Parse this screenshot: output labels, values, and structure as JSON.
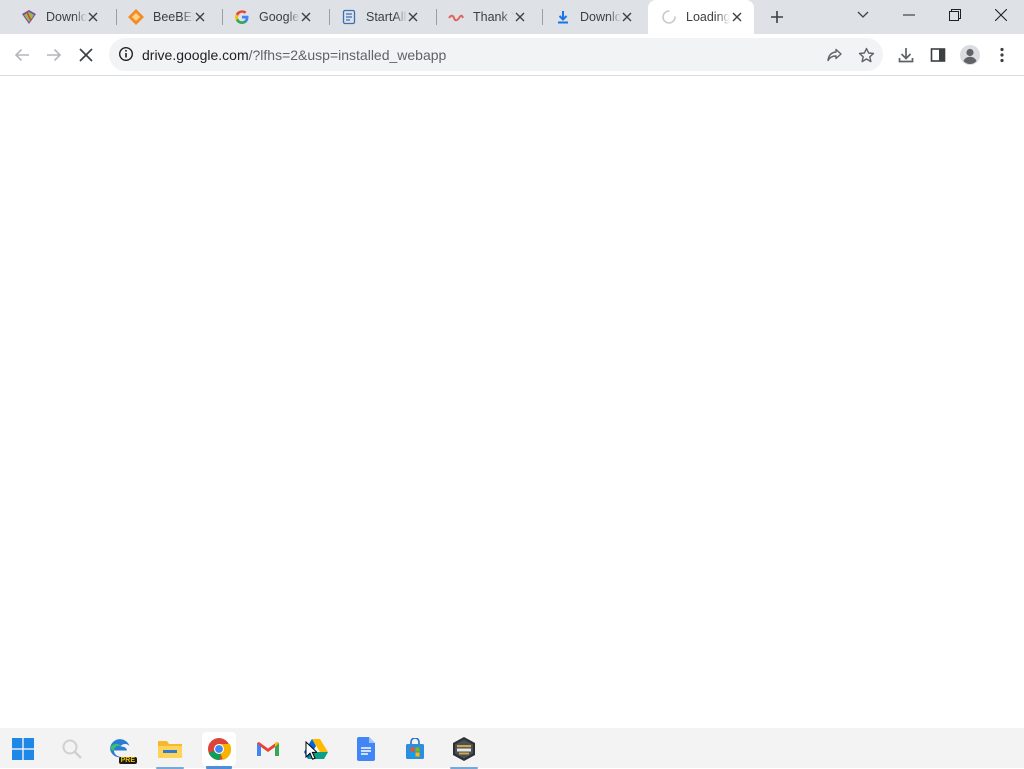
{
  "browser": {
    "tabs": [
      {
        "title": "Downlo",
        "icon": "winrar-icon"
      },
      {
        "title": "BeeBEEP",
        "icon": "beebeep-icon"
      },
      {
        "title": "Google",
        "icon": "google-g-icon"
      },
      {
        "title": "StartAllBack",
        "icon": "document-icon"
      },
      {
        "title": "Thank You",
        "icon": "link-icon"
      },
      {
        "title": "Downlo",
        "icon": "download-arrow-icon"
      },
      {
        "title": "Loading",
        "icon": "loading-spinner-icon",
        "active": true
      }
    ],
    "address": {
      "host": "drive.google.com",
      "path": "/?lfhs=2&usp=installed_webapp"
    }
  },
  "taskbar": {
    "items": [
      "windows-start-icon",
      "search-icon",
      "edge-preview-icon",
      "file-explorer-icon",
      "chrome-icon",
      "gmail-icon",
      "google-drive-icon",
      "google-docs-icon",
      "microsoft-store-icon",
      "game-app-icon"
    ],
    "edge_badge": "PRE"
  },
  "colors": {
    "tabstrip": "#dee1e6",
    "omnibox": "#f1f3f4",
    "icon_grey": "#5f6368",
    "taskbar": "#f3f3f3"
  }
}
